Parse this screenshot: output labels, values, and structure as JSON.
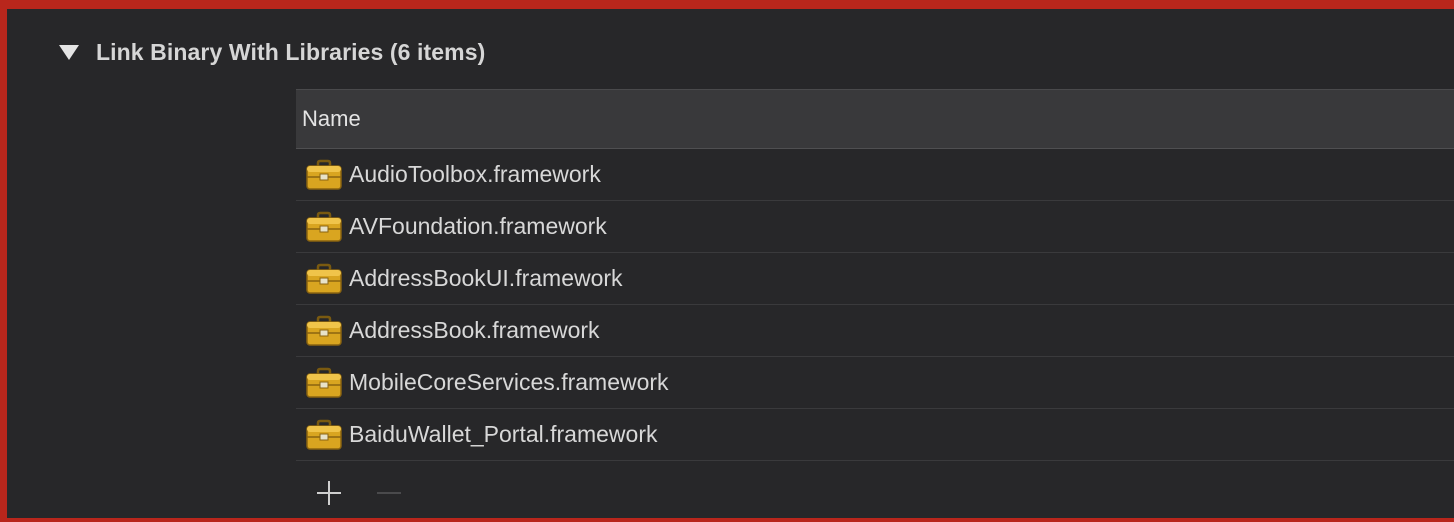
{
  "section": {
    "title": "Link Binary With Libraries (6 items)",
    "disclosure_icon": "triangle-down-icon"
  },
  "table": {
    "column_name": "Name",
    "rows": [
      {
        "label": "AudioToolbox.framework",
        "icon": "framework-toolbox-icon"
      },
      {
        "label": "AVFoundation.framework",
        "icon": "framework-toolbox-icon"
      },
      {
        "label": "AddressBookUI.framework",
        "icon": "framework-toolbox-icon"
      },
      {
        "label": "AddressBook.framework",
        "icon": "framework-toolbox-icon"
      },
      {
        "label": "MobileCoreServices.framework",
        "icon": "framework-toolbox-icon"
      },
      {
        "label": "BaiduWallet_Portal.framework",
        "icon": "framework-toolbox-icon"
      }
    ]
  },
  "toolbar": {
    "add_icon": "plus-icon",
    "remove_icon": "minus-icon",
    "remove_enabled": false
  },
  "colors": {
    "frame_border": "#b8261c",
    "panel_background": "#272729",
    "header_background": "#39393b",
    "text": "#d8d8d8",
    "icon_gold": "#d9a520"
  }
}
